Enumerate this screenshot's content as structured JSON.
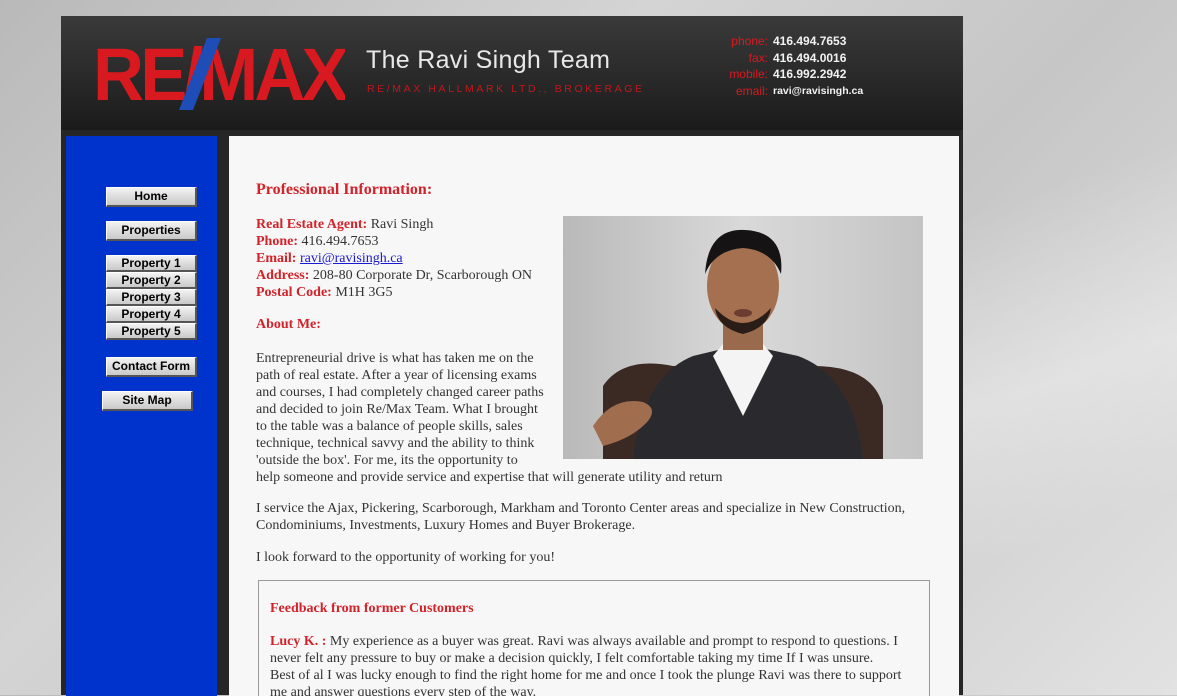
{
  "header": {
    "logo_text": "RE/MAX",
    "team_name": "The Ravi Singh Team",
    "brokerage": "RE/MAX HALLMARK LTD., BROKERAGE",
    "contacts": [
      {
        "label": "phone:",
        "value": "416.494.7653"
      },
      {
        "label": "fax:",
        "value": "416.494.0016"
      },
      {
        "label": "mobile:",
        "value": "416.992.2942"
      },
      {
        "label": "email:",
        "value": "ravi@ravisingh.ca"
      }
    ]
  },
  "nav": {
    "home": "Home",
    "properties": "Properties",
    "property1": "Property 1",
    "property2": "Property 2",
    "property3": "Property 3",
    "property4": "Property 4",
    "property5": "Property 5",
    "contact_form": "Contact Form",
    "site_map": "Site Map"
  },
  "profile": {
    "section_title": "Professional Information:",
    "agent_label": "Real Estate Agent:",
    "agent_value": "Ravi Singh",
    "phone_label": "Phone:",
    "phone_value": "416.494.7653",
    "email_label": "Email:",
    "email_value": "ravi@ravisingh.ca",
    "address_label": "Address:",
    "address_value": "208-80 Corporate Dr, Scarborough ON",
    "postal_label": "Postal Code:",
    "postal_value": "M1H 3G5"
  },
  "about": {
    "title": "About Me:",
    "lines": [
      "Entrepreneurial drive is what has taken me on the",
      "path of real estate. After a year of licensing exams",
      "and courses, I had completely changed career paths",
      "and decided to join Re/Max Team. What I brought",
      "to the table was a balance of people skills, sales",
      "technique, technical savvy and the ability to think",
      "'outside the box'. For me, its the opportunity to",
      "help someone and provide service and expertise that will generate utility and return"
    ],
    "service_lines": [
      "I service the Ajax, Pickering, Scarborough, Markham and Toronto Center areas and specialize in New Construction,",
      "Condominiums, Investments, Luxury Homes and Buyer Brokerage."
    ],
    "forward": "I look forward to the opportunity of working for you!"
  },
  "feedback": {
    "title": "Feedback from former Customers",
    "author": "Lucy K. :",
    "lines": [
      " My experience as a buyer was great. Ravi was always available and prompt to respond to questions. I",
      "never felt any pressure to buy or make a decision quickly, I felt comfortable taking my time If I was unsure.",
      "Best of al I was lucky enough to find the right home for me and once I took the plunge Ravi was there to support",
      "me and answer questions every step of the way."
    ]
  },
  "colors": {
    "accent_red": "#d2232a",
    "sidebar_blue": "#0033cc",
    "header_dark": "#1b1b1b"
  }
}
